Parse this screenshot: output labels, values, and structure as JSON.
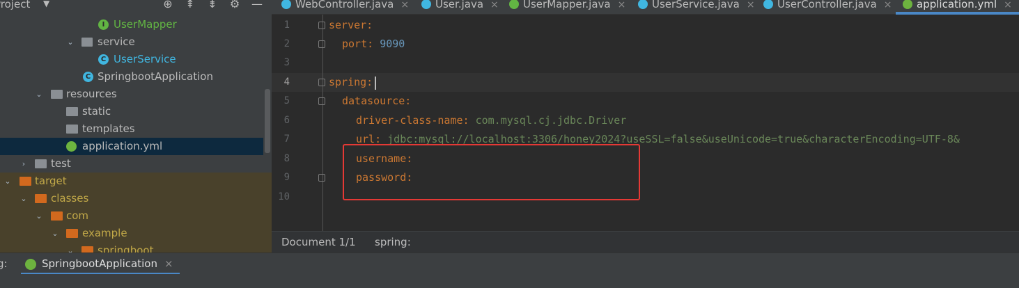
{
  "project": {
    "title": "Project",
    "tree": [
      {
        "label": "UserMapper",
        "kind": "interface"
      },
      {
        "label": "service",
        "kind": "package"
      },
      {
        "label": "UserService",
        "kind": "class"
      },
      {
        "label": "SpringbootApplication",
        "kind": "spring-class"
      },
      {
        "label": "resources",
        "kind": "resource-folder"
      },
      {
        "label": "static",
        "kind": "folder"
      },
      {
        "label": "templates",
        "kind": "folder"
      },
      {
        "label": "application.yml",
        "kind": "yaml",
        "selected": true
      },
      {
        "label": "test",
        "kind": "folder"
      },
      {
        "label": "target",
        "kind": "excluded-folder"
      },
      {
        "label": "classes",
        "kind": "excluded-folder"
      },
      {
        "label": "com",
        "kind": "excluded-folder"
      },
      {
        "label": "example",
        "kind": "excluded-folder"
      },
      {
        "label": "springboot",
        "kind": "excluded-folder"
      }
    ]
  },
  "tabs": [
    {
      "label": "WebController.java",
      "icon": "class-icon"
    },
    {
      "label": "User.java",
      "icon": "class-icon"
    },
    {
      "label": "UserMapper.java",
      "icon": "interface-icon"
    },
    {
      "label": "UserService.java",
      "icon": "class-icon"
    },
    {
      "label": "UserController.java",
      "icon": "class-icon"
    },
    {
      "label": "application.yml",
      "icon": "spring-yaml-icon",
      "active": true
    }
  ],
  "editor": {
    "line_numbers": [
      "1",
      "2",
      "3",
      "4",
      "5",
      "6",
      "7",
      "8",
      "9",
      "10"
    ],
    "current_line": "4",
    "lines": {
      "l1_key": "server:",
      "l2_key": "port:",
      "l2_val": "9090",
      "l4_key": "spring:",
      "l5_key": "datasource:",
      "l6_key": "driver-class-name:",
      "l6_val": "com.mysql.cj.jdbc.Driver",
      "l7_key": "url:",
      "l7_val": "jdbc:mysql://localhost:3306/honey2024?useSSL=false&useUnicode=true&characterEncoding=UTF-8&",
      "l8_key": "username:",
      "l9_key": "password:"
    }
  },
  "breadcrumb": {
    "doc": "Document 1/1",
    "path": "spring:"
  },
  "run": {
    "label": "g:",
    "config": "SpringbootApplication",
    "close": "×"
  },
  "colors": {
    "keyword": "#cc7832",
    "string": "#6a8759",
    "number": "#6897bb",
    "highlight_box": "#e53935",
    "accent": "#4a88c7"
  }
}
